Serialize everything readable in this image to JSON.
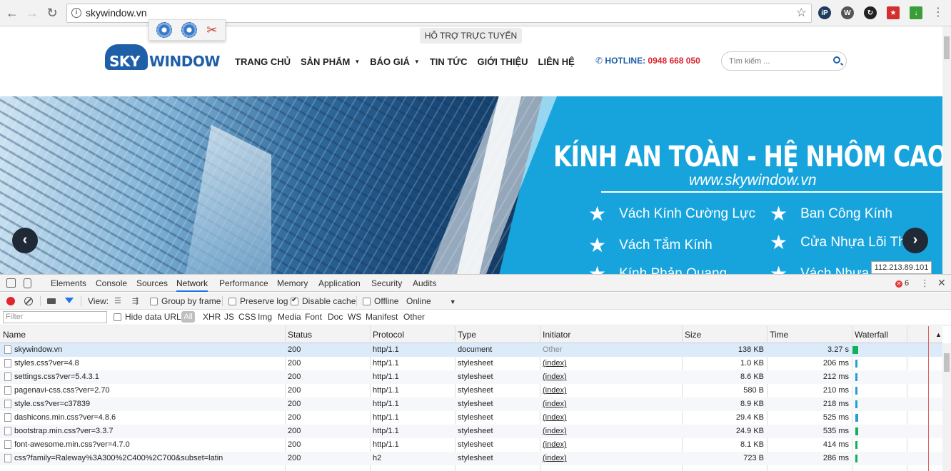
{
  "browser": {
    "url": "skywindow.vn",
    "extensions": [
      "ip-icon",
      "wordpress-icon",
      "sync-icon",
      "flag-icon",
      "download-icon"
    ]
  },
  "site": {
    "support_label": "HỖ TRỢ TRỰC TUYẾN",
    "logo": {
      "sky": "SKY",
      "window": "WINDOW"
    },
    "nav": [
      {
        "label": "TRANG CHỦ",
        "caret": false
      },
      {
        "label": "SẢN PHẨM",
        "caret": true
      },
      {
        "label": "BÁO GIÁ",
        "caret": true
      },
      {
        "label": "TIN TỨC",
        "caret": false
      },
      {
        "label": "GIỚI THIỆU",
        "caret": false
      },
      {
        "label": "LIÊN HỆ",
        "caret": false
      }
    ],
    "hotline_label": "HOTLINE:",
    "hotline_number": "0948 668 050",
    "search_placeholder": "Tìm kiếm ...",
    "banner": {
      "title": "KÍNH AN TOÀN - HỆ NHÔM CAO CẤP",
      "url": "www.skywindow.vn",
      "features": [
        "Vách Kính Cường Lực",
        "Ban Công Kính",
        "Vách Tắm Kính",
        "Cửa Nhựa Lõi Thép",
        "Kính Phản Quang",
        "Vách Nhựa"
      ]
    },
    "ip_tooltip": "112.213.89.101"
  },
  "devtools": {
    "tabs": [
      "Elements",
      "Console",
      "Sources",
      "Network",
      "Performance",
      "Memory",
      "Application",
      "Security",
      "Audits"
    ],
    "active_tab": "Network",
    "error_count": "6",
    "toolbar": {
      "view_label": "View:",
      "group_by_frame": "Group by frame",
      "preserve_log": "Preserve log",
      "disable_cache": "Disable cache",
      "offline": "Offline",
      "throttle": "Online"
    },
    "filter": {
      "placeholder": "Filter",
      "hide_data_urls": "Hide data URLs",
      "types": [
        "All",
        "XHR",
        "JS",
        "CSS",
        "Img",
        "Media",
        "Font",
        "Doc",
        "WS",
        "Manifest",
        "Other"
      ]
    },
    "columns": [
      "Name",
      "Status",
      "Protocol",
      "Type",
      "Initiator",
      "Size",
      "Time",
      "Waterfall"
    ],
    "rows": [
      {
        "name": "skywindow.vn",
        "status": "200",
        "protocol": "http/1.1",
        "type": "document",
        "initiator": "Other",
        "size": "138 KB",
        "time": "3.27 s"
      },
      {
        "name": "styles.css?ver=4.8",
        "status": "200",
        "protocol": "http/1.1",
        "type": "stylesheet",
        "initiator": "(index)",
        "size": "1.0 KB",
        "time": "206 ms"
      },
      {
        "name": "settings.css?ver=5.4.3.1",
        "status": "200",
        "protocol": "http/1.1",
        "type": "stylesheet",
        "initiator": "(index)",
        "size": "8.6 KB",
        "time": "212 ms"
      },
      {
        "name": "pagenavi-css.css?ver=2.70",
        "status": "200",
        "protocol": "http/1.1",
        "type": "stylesheet",
        "initiator": "(index)",
        "size": "580 B",
        "time": "210 ms"
      },
      {
        "name": "style.css?ver=c37839",
        "status": "200",
        "protocol": "http/1.1",
        "type": "stylesheet",
        "initiator": "(index)",
        "size": "8.9 KB",
        "time": "218 ms"
      },
      {
        "name": "dashicons.min.css?ver=4.8.6",
        "status": "200",
        "protocol": "http/1.1",
        "type": "stylesheet",
        "initiator": "(index)",
        "size": "29.4 KB",
        "time": "525 ms"
      },
      {
        "name": "bootstrap.min.css?ver=3.3.7",
        "status": "200",
        "protocol": "http/1.1",
        "type": "stylesheet",
        "initiator": "(index)",
        "size": "24.9 KB",
        "time": "535 ms"
      },
      {
        "name": "font-awesome.min.css?ver=4.7.0",
        "status": "200",
        "protocol": "http/1.1",
        "type": "stylesheet",
        "initiator": "(index)",
        "size": "8.1 KB",
        "time": "414 ms"
      },
      {
        "name": "css?family=Raleway%3A300%2C400%2C700&subset=latin",
        "status": "200",
        "protocol": "h2",
        "type": "stylesheet",
        "initiator": "(index)",
        "size": "723 B",
        "time": "286 ms"
      }
    ]
  }
}
